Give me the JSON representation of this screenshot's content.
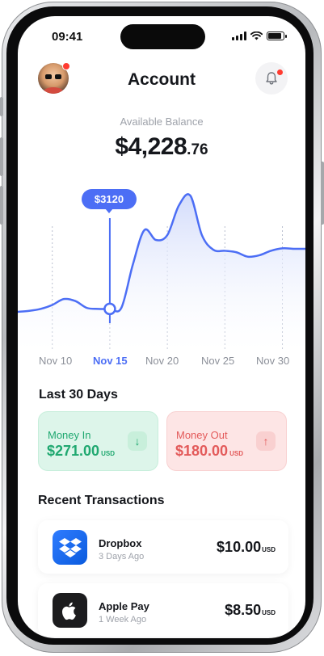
{
  "status_bar": {
    "time": "09:41"
  },
  "header": {
    "title": "Account"
  },
  "balance": {
    "label": "Available Balance",
    "amount_main": "$4,228",
    "amount_cents": ".76"
  },
  "chart_data": {
    "type": "line",
    "x_ticks": [
      "Nov 10",
      "Nov 15",
      "Nov 20",
      "Nov 25",
      "Nov 30"
    ],
    "selected_tick": "Nov 15",
    "tooltip": "$3120",
    "series": [
      {
        "x": [
          7,
          8,
          9,
          10,
          11,
          12,
          13,
          14,
          15,
          16,
          17,
          18,
          19,
          20,
          21,
          22,
          23,
          24,
          25,
          26,
          27,
          28,
          29,
          30,
          31,
          32
        ],
        "y": [
          2640,
          2660,
          2700,
          2780,
          2900,
          2860,
          2720,
          2700,
          2700,
          2720,
          3600,
          4300,
          4100,
          4200,
          4800,
          5000,
          4200,
          3900,
          3880,
          3850,
          3760,
          3790,
          3880,
          3930,
          3920,
          3920
        ]
      }
    ],
    "selected_point": {
      "x": 15,
      "y": 2700
    },
    "colors": {
      "line": "#4c6ef5",
      "fill": "#dfe6fd"
    }
  },
  "summary": {
    "title": "Last 30 Days",
    "money_in": {
      "label": "Money In",
      "amount": "$271.00",
      "currency": "USD"
    },
    "money_out": {
      "label": "Money Out",
      "amount": "$180.00",
      "currency": "USD"
    }
  },
  "transactions": {
    "title": "Recent Transactions",
    "items": [
      {
        "name": "Dropbox",
        "sub": "3 Days Ago",
        "amount": "$10.00",
        "currency": "USD"
      },
      {
        "name": "Apple Pay",
        "sub": "1 Week Ago",
        "amount": "$8.50",
        "currency": "USD"
      }
    ]
  }
}
